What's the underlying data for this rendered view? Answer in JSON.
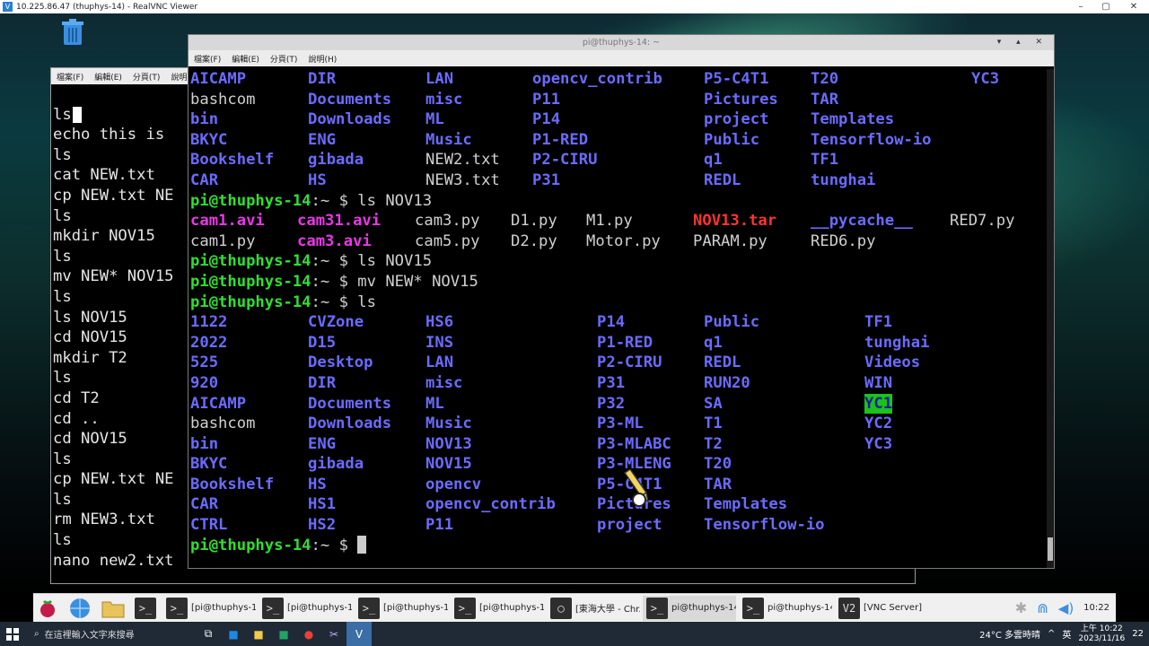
{
  "vnc": {
    "title": "10.225.86.47 (thuphys-14) - RealVNC Viewer",
    "min": "–",
    "max": "▢",
    "close": "✕"
  },
  "back_window": {
    "menu": [
      "檔案(F)",
      "編輯(E)",
      "分頁(T)",
      "說明"
    ],
    "lines": [
      "ls",
      "echo this is",
      "ls",
      "cat NEW.txt",
      "cp NEW.txt NE",
      "ls",
      "mkdir NOV15",
      "ls",
      "mv NEW* NOV15",
      "ls",
      "ls NOV15",
      "cd NOV15",
      "mkdir T2",
      "ls",
      "cd T2",
      "cd ..",
      "cd NOV15",
      "ls",
      "cp NEW.txt NE",
      "ls",
      "rm NEW3.txt",
      "ls",
      "nano new2.txt"
    ]
  },
  "front_window": {
    "title": "pi@thuphys-14: ~",
    "controls": "▾ ▴ ✕",
    "menu": [
      "檔案(F)",
      "編輯(E)",
      "分頁(T)",
      "說明(H)"
    ],
    "prompt": {
      "user": "pi@thuphys-14",
      "rest": ":~ $ "
    },
    "cmd1": "ls NOV13",
    "cmd2": "ls NOV15",
    "cmd3": "mv NEW* NOV15",
    "cmd4": "ls"
  },
  "panel": {
    "items": [
      {
        "icon": ">_",
        "label": ""
      },
      {
        "icon": ">_",
        "label": "[pi@thuphys-1..."
      },
      {
        "icon": ">_",
        "label": "[pi@thuphys-1..."
      },
      {
        "icon": ">_",
        "label": "[pi@thuphys-1..."
      },
      {
        "icon": ">_",
        "label": "[pi@thuphys-1..."
      },
      {
        "icon": "◯",
        "label": "[東海大學 - Chr..."
      },
      {
        "icon": ">_",
        "label": "pi@thuphys-14..."
      },
      {
        "icon": ">_",
        "label": "pi@thuphys-14..."
      },
      {
        "icon": "V2",
        "label": "[VNC Server]"
      }
    ],
    "clock": "10:22"
  },
  "taskbar": {
    "search_placeholder": "在這裡輸入文字來搜尋",
    "weather": "24°C 多雲時晴",
    "ime": "英",
    "time": "上午 10:22",
    "date": "2023/11/16",
    "notif": "22"
  }
}
